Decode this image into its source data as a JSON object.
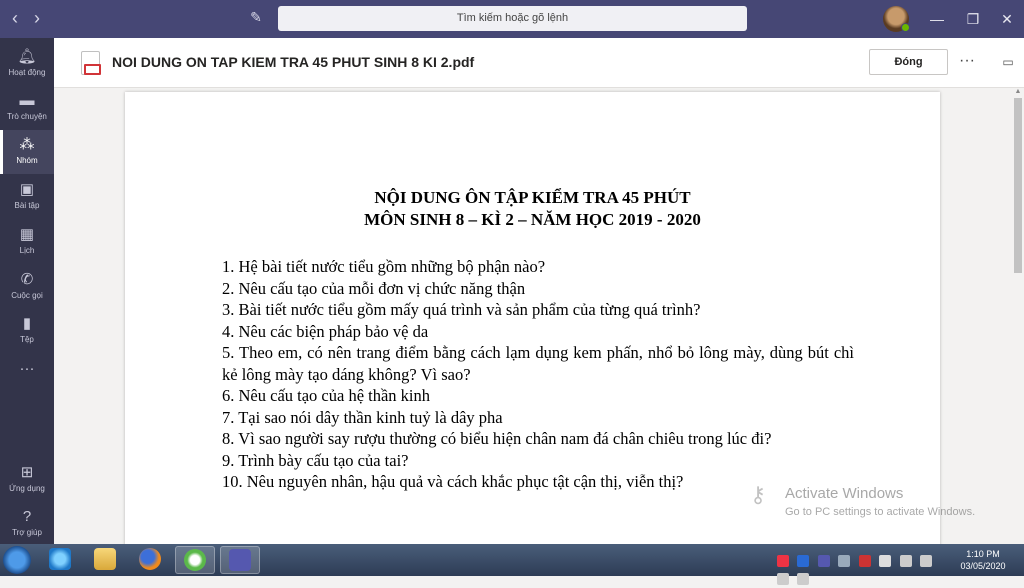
{
  "titlebar": {
    "search_placeholder": "Tìm kiếm hoặc gõ lệnh",
    "icons": [
      "back-arrow-icon",
      "forward-arrow-icon",
      "compose-icon",
      "minimize-icon",
      "maximize-icon",
      "close-icon"
    ]
  },
  "rail": {
    "items": [
      {
        "label": "Hoạt động",
        "icon": "bell-icon"
      },
      {
        "label": "Trò chuyện",
        "icon": "chat-icon"
      },
      {
        "label": "Nhóm",
        "icon": "teams-icon",
        "active": true
      },
      {
        "label": "Bài tập",
        "icon": "assignments-icon"
      },
      {
        "label": "Lịch",
        "icon": "calendar-icon"
      },
      {
        "label": "Cuộc gọi",
        "icon": "phone-icon"
      },
      {
        "label": "Tệp",
        "icon": "file-icon"
      },
      {
        "label": "",
        "icon": "more-icon"
      },
      {
        "label": "Ứng dụng",
        "icon": "apps-icon"
      },
      {
        "label": "Trợ giúp",
        "icon": "help-icon"
      }
    ]
  },
  "header": {
    "file_name": "NOI DUNG ON TAP KIEM TRA 45 PHUT SINH 8 KI 2.pdf",
    "close_label": "Đóng",
    "more_label": "···"
  },
  "document": {
    "heading_line1": "NỘI DUNG ÔN TẬP KIỂM TRA 45 PHÚT",
    "heading_line2": "MÔN SINH 8 – KÌ 2 – NĂM HỌC 2019 - 2020",
    "questions": [
      "1. Hệ bài tiết nước tiểu gồm những bộ phận nào?",
      "2. Nêu cấu tạo của mỗi đơn vị chức năng thận",
      "3. Bài tiết nước tiểu gồm mấy quá trình và sản phẩm của từng quá trình?",
      "4. Nêu các biện pháp bảo vệ da",
      "5. Theo em, có nên trang điểm bằng cách lạm dụng kem phấn, nhổ bỏ lông mày, dùng bút chì kẻ lông mày tạo dáng không? Vì sao?",
      "6. Nêu cấu tạo của hệ thần kinh",
      "7. Tại sao nói dây thần kinh tuỷ là dây pha",
      "8. Vì sao người say rượu thường có biểu hiện chân nam đá chân chiêu trong lúc đi?",
      "9. Trình bày cấu tạo của tai?",
      "10.  Nêu nguyên nhân, hậu quả và cách khắc phục tật cận thị, viễn thị?"
    ]
  },
  "watermark": {
    "line1": "Activate Windows",
    "line2": "Go to PC settings to activate Windows."
  },
  "taskbar": {
    "apps": [
      "internet-explorer-icon",
      "file-explorer-icon",
      "firefox-icon",
      "coccoc-icon",
      "teams-taskbar-icon"
    ],
    "time": "1:10 PM",
    "date": "03/05/2020"
  }
}
